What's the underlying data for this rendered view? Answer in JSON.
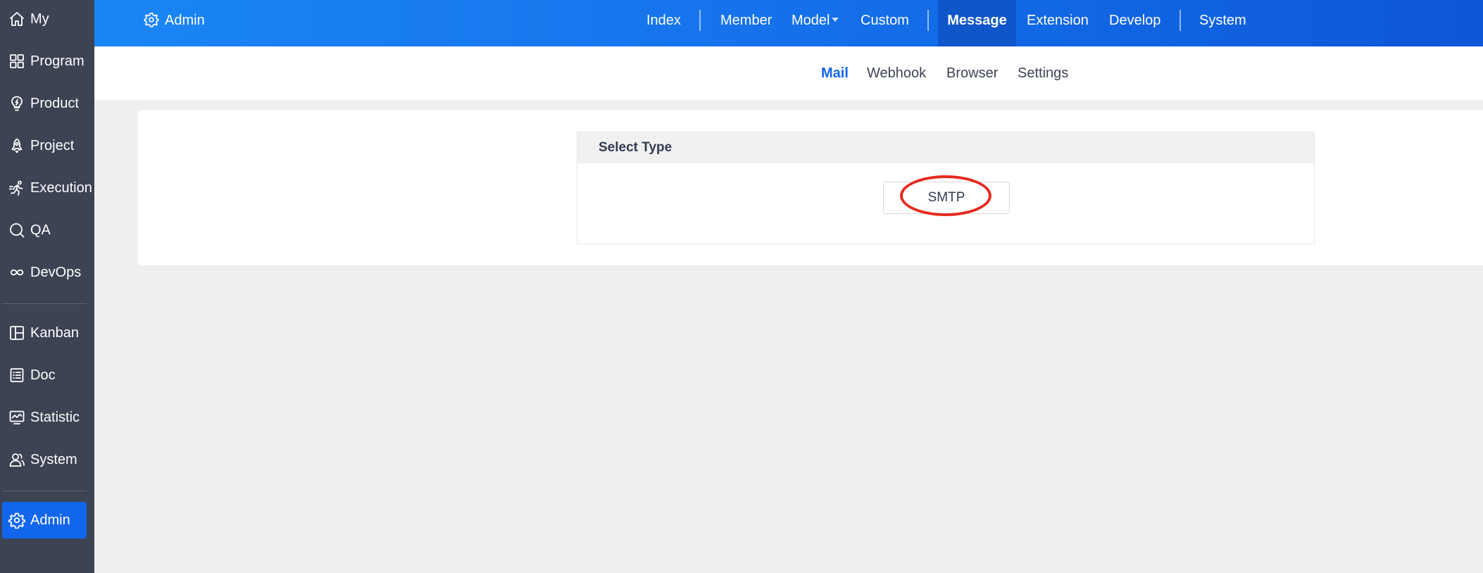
{
  "sidebar": {
    "items": [
      {
        "label": "My",
        "icon": "home-icon"
      },
      {
        "label": "Program",
        "icon": "grid-icon"
      },
      {
        "label": "Product",
        "icon": "bulb-icon"
      },
      {
        "label": "Project",
        "icon": "rocket-icon"
      },
      {
        "label": "Execution",
        "icon": "run-icon"
      },
      {
        "label": "QA",
        "icon": "qa-icon"
      },
      {
        "label": "DevOps",
        "icon": "infinity-icon"
      },
      {
        "label": "Kanban",
        "icon": "kanban-icon"
      },
      {
        "label": "Doc",
        "icon": "doc-icon"
      },
      {
        "label": "Statistic",
        "icon": "chart-icon"
      },
      {
        "label": "System",
        "icon": "users-icon"
      },
      {
        "label": "Admin",
        "icon": "gear-icon"
      }
    ]
  },
  "header": {
    "app_label": "Admin",
    "nav": [
      {
        "label": "Index"
      },
      {
        "label": "Member"
      },
      {
        "label": "Model"
      },
      {
        "label": "Custom"
      },
      {
        "label": "Message"
      },
      {
        "label": "Extension"
      },
      {
        "label": "Develop"
      },
      {
        "label": "System"
      }
    ],
    "active_nav": "Message"
  },
  "subnav": {
    "items": [
      {
        "label": "Mail"
      },
      {
        "label": "Webhook"
      },
      {
        "label": "Browser"
      },
      {
        "label": "Settings"
      }
    ],
    "active": "Mail"
  },
  "main": {
    "panel_title": "Select Type",
    "smtp_label": "SMTP"
  },
  "colors": {
    "sidebar_bg": "#3c4353",
    "accent": "#1266ec",
    "annotation": "#e52a1f"
  }
}
